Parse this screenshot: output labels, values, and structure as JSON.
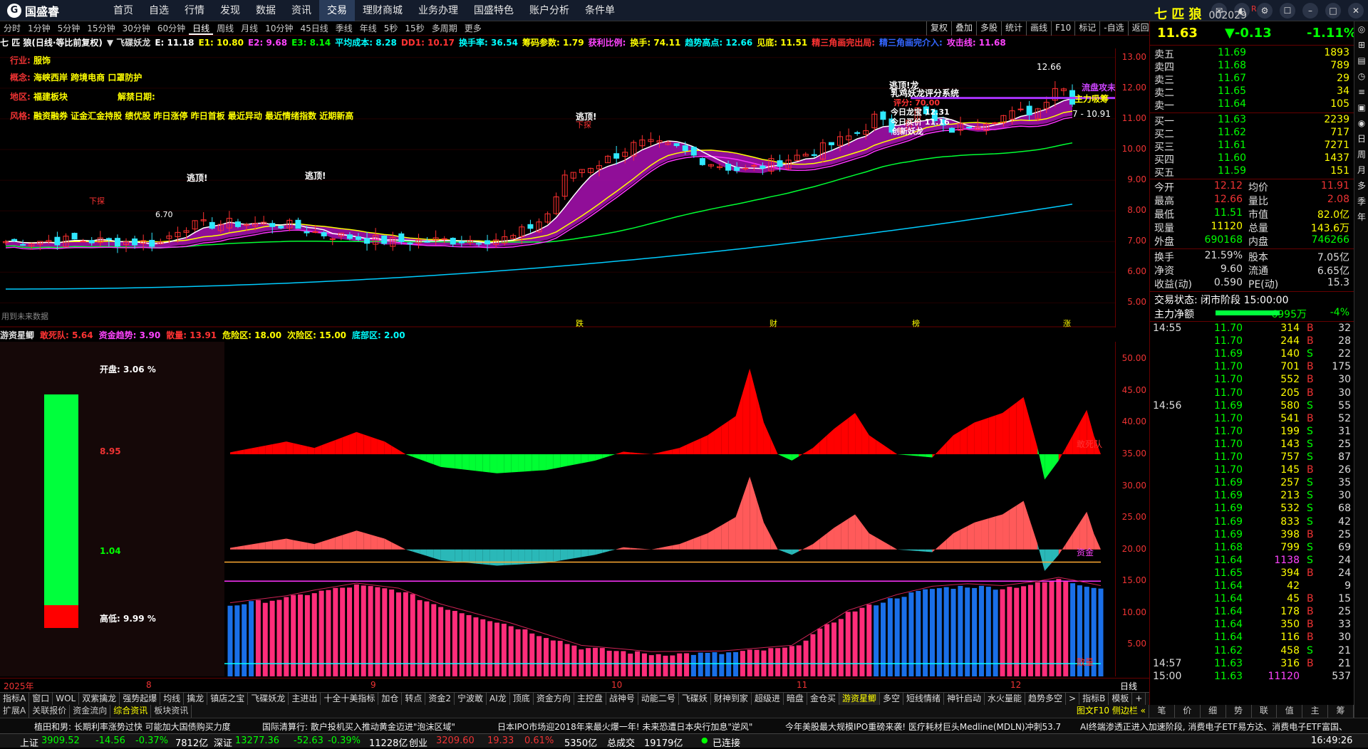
{
  "app": {
    "name": "国盛睿"
  },
  "menu": [
    "首页",
    "自选",
    "行情",
    "发现",
    "数据",
    "资讯",
    "交易",
    "理财商城",
    "业务办理",
    "国盛特色",
    "账户分析",
    "条件单"
  ],
  "menu_active": 6,
  "periods": [
    "分时",
    "1分钟",
    "5分钟",
    "15分钟",
    "30分钟",
    "60分钟",
    "日线",
    "周线",
    "月线",
    "10分钟",
    "45日线",
    "季线",
    "年线",
    "5秒",
    "15秒",
    "多周期",
    "更多"
  ],
  "period_active": 6,
  "tools": [
    "复权",
    "叠加",
    "多股",
    "统计",
    "画线",
    "F10",
    "标记",
    "-自选",
    "返回"
  ],
  "indicator_line": [
    {
      "text": "七 匹 狼(日线·等比前复权)",
      "color": "#ffffff"
    },
    {
      "text": "▼ 飞碟妖龙",
      "color": "#dddddd"
    },
    {
      "text": "E: 11.18",
      "color": "#ffffff"
    },
    {
      "text": "E1: 10.80",
      "color": "#ffff00"
    },
    {
      "text": "E2: 9.68",
      "color": "#ff44ff"
    },
    {
      "text": "E3: 8.14",
      "color": "#00ff00"
    },
    {
      "text": "平均成本: 8.28",
      "color": "#00ffff"
    },
    {
      "text": "DD1: 10.17",
      "color": "#ff3333"
    },
    {
      "text": "换手率: 36.54",
      "color": "#00ffff"
    },
    {
      "text": "筹码参数: 1.79",
      "color": "#ffff00"
    },
    {
      "text": "获利比例:",
      "color": "#ff44ff"
    },
    {
      "text": "换手: 74.11",
      "color": "#ffff00"
    },
    {
      "text": "趋势高点: 12.66",
      "color": "#00ffff"
    },
    {
      "text": "见底: 11.51",
      "color": "#ffff00"
    },
    {
      "text": "精三角画完出局:",
      "color": "#ff3333"
    },
    {
      "text": "精三角画完介入:",
      "color": "#3366ff"
    },
    {
      "text": "攻击线: 11.68",
      "color": "#ff44ff"
    }
  ],
  "stock_info": {
    "industry_label": "行业:",
    "industry": "服饰",
    "concept_label": "概念:",
    "concept": "海峡西岸 跨境电商 口罩防护",
    "region_label": "地区:",
    "region": "福建板块",
    "unlock_label": "解禁日期:",
    "style_label": "风格:",
    "style": "融资融券 证金汇金持股 绩优股 昨日涨停 昨日首板 最近异动 最近情绪指数 近期新高"
  },
  "main_chart": {
    "y_ticks": [
      "13.00",
      "12.00",
      "11.00",
      "10.00",
      "9.00",
      "8.00",
      "7.00",
      "6.00",
      "5.00"
    ],
    "annotations": {
      "high_price": "12.66",
      "low_price": "6.70",
      "last_line": "7 - 10.91",
      "xiaocheng": "逃顶!",
      "xiaocheng2": "逃顶!",
      "xiaocheng3": "逃顶!",
      "xiaocheng4": "逃顶!龙",
      "xiafang": "下探",
      "xiafang2": "下探",
      "system": "乳鸡妖龙评分系统",
      "score_label": "评分: 70.00",
      "today_dragon": "今日龙宝 12.31",
      "today_buy": "今日买价 11.16",
      "create_new": "创新妖龙",
      "liudong": "流盘攻未",
      "main_force": "主力吸筹",
      "future": "用到未来数据",
      "events": [
        "跌",
        "财",
        "榜",
        "涨"
      ]
    }
  },
  "sub_chart": {
    "title": "游资星鲫",
    "legend": [
      {
        "text": "敢死队: 5.64",
        "color": "#ff3333"
      },
      {
        "text": "资金趋势: 3.90",
        "color": "#ff44ff"
      },
      {
        "text": "散量: 13.91",
        "color": "#ff3333"
      },
      {
        "text": "危险区: 18.00",
        "color": "#ffff00"
      },
      {
        "text": "次险区: 15.00",
        "color": "#ffff00"
      },
      {
        "text": "底部区: 2.00",
        "color": "#00ffff"
      }
    ],
    "y_ticks": [
      "50.00",
      "45.00",
      "40.00",
      "35.00",
      "30.00",
      "25.00",
      "20.00",
      "15.00",
      "10.00",
      "5.00"
    ],
    "labels": {
      "gansi": "敢死队",
      "zijin": "资金",
      "sanliang": "散量"
    }
  },
  "gauge": {
    "open_label": "开盘:",
    "open": "3.06 %",
    "upper": "8.95",
    "lower": "1.04",
    "hilo_label": "高低:",
    "hilo": "9.99 %"
  },
  "dates": [
    {
      "t": "2025年"
    },
    {
      "t": "8"
    },
    {
      "t": "9"
    },
    {
      "t": "10"
    },
    {
      "t": "11"
    },
    {
      "t": "12"
    }
  ],
  "date_period": "日线",
  "tabs1": [
    "指标A",
    "窗口",
    "WOL",
    "双紫擒龙",
    "强势起爆",
    "均线",
    "擒龙",
    "镇店之宝",
    "飞碟妖龙",
    "主进出",
    "十全十美指标",
    "加仓",
    "转点",
    "资金2",
    "宁波敢",
    "AI龙",
    "顶底",
    "资金方向",
    "主控盘",
    "战神号",
    "动能二号",
    "飞碟妖",
    "财神到家",
    "超级进",
    "暗盘",
    "金仓买",
    "游资星鲫",
    "多空",
    "短线情绪",
    "神针启动",
    "水火量能",
    "趋势多空",
    ">",
    "指标B",
    "模板",
    "+",
    "-"
  ],
  "tabs1_active": 26,
  "tabs2": [
    "扩展A",
    "关联报价",
    "资金流向",
    "综合资讯",
    "板块资讯"
  ],
  "tabs2_right": "图文F10 侧边栏 «",
  "right_panel": {
    "name": "七 匹 狼",
    "code": "002029",
    "mark": "R",
    "price": "11.63",
    "change": "▼-0.13",
    "pct": "-1.11%",
    "asks": [
      {
        "label": "卖五",
        "price": "11.69",
        "vol": "1893"
      },
      {
        "label": "卖四",
        "price": "11.68",
        "vol": "789"
      },
      {
        "label": "卖三",
        "price": "11.67",
        "vol": "29"
      },
      {
        "label": "卖二",
        "price": "11.65",
        "vol": "34"
      },
      {
        "label": "卖一",
        "price": "11.64",
        "vol": "105"
      }
    ],
    "bids": [
      {
        "label": "买一",
        "price": "11.63",
        "vol": "2239"
      },
      {
        "label": "买二",
        "price": "11.62",
        "vol": "717"
      },
      {
        "label": "买三",
        "price": "11.61",
        "vol": "7271"
      },
      {
        "label": "买四",
        "price": "11.60",
        "vol": "1437"
      },
      {
        "label": "买五",
        "price": "11.59",
        "vol": "151"
      }
    ],
    "stats": [
      {
        "l1": "今开",
        "v1": "12.12",
        "l2": "均价",
        "v2": "11.91"
      },
      {
        "l1": "最高",
        "v1": "12.66",
        "l2": "量比",
        "v2": "2.08"
      },
      {
        "l1": "最低",
        "v1": "11.51",
        "l2": "市值",
        "v2": "82.0亿"
      },
      {
        "l1": "现量",
        "v1": "11120",
        "l2": "总量",
        "v2": "143.6万"
      },
      {
        "l1": "外盘",
        "v1": "690168",
        "l2": "内盘",
        "v2": "746266"
      }
    ],
    "stats2": [
      {
        "l1": "换手",
        "v1": "21.59%",
        "l2": "股本",
        "v2": "7.05亿"
      },
      {
        "l1": "净资",
        "v1": "9.60",
        "l2": "流通",
        "v2": "6.65亿"
      },
      {
        "l1": "收益(动)",
        "v1": "0.590",
        "l2": "PE(动)",
        "v2": "15.3"
      }
    ],
    "trade_state": "交易状态: 闭市阶段 15:00:00",
    "net_label": "主力净额",
    "net_value": "-6995万",
    "net_pct": "-4%",
    "ticks": [
      {
        "time": "14:55",
        "price": "11.70",
        "vol": "314",
        "bs": "B",
        "n": "32"
      },
      {
        "time": "",
        "price": "11.70",
        "vol": "244",
        "bs": "B",
        "n": "28"
      },
      {
        "time": "",
        "price": "11.69",
        "vol": "140",
        "bs": "S",
        "n": "22"
      },
      {
        "time": "",
        "price": "11.70",
        "vol": "701",
        "bs": "B",
        "n": "175"
      },
      {
        "time": "",
        "price": "11.70",
        "vol": "552",
        "bs": "B",
        "n": "30"
      },
      {
        "time": "",
        "price": "11.70",
        "vol": "205",
        "bs": "B",
        "n": "30"
      },
      {
        "time": "14:56",
        "price": "11.69",
        "vol": "580",
        "bs": "S",
        "n": "55"
      },
      {
        "time": "",
        "price": "11.70",
        "vol": "541",
        "bs": "B",
        "n": "52"
      },
      {
        "time": "",
        "price": "11.70",
        "vol": "199",
        "bs": "S",
        "n": "31"
      },
      {
        "time": "",
        "price": "11.70",
        "vol": "143",
        "bs": "S",
        "n": "25"
      },
      {
        "time": "",
        "price": "11.70",
        "vol": "757",
        "bs": "S",
        "n": "87"
      },
      {
        "time": "",
        "price": "11.70",
        "vol": "145",
        "bs": "B",
        "n": "26"
      },
      {
        "time": "",
        "price": "11.69",
        "vol": "257",
        "bs": "S",
        "n": "35"
      },
      {
        "time": "",
        "price": "11.69",
        "vol": "213",
        "bs": "S",
        "n": "30"
      },
      {
        "time": "",
        "price": "11.69",
        "vol": "532",
        "bs": "S",
        "n": "68"
      },
      {
        "time": "",
        "price": "11.69",
        "vol": "833",
        "bs": "S",
        "n": "42"
      },
      {
        "time": "",
        "price": "11.69",
        "vol": "398",
        "bs": "B",
        "n": "25"
      },
      {
        "time": "",
        "price": "11.68",
        "vol": "799",
        "bs": "S",
        "n": "69"
      },
      {
        "time": "",
        "price": "11.64",
        "vol": "1138",
        "bs": "S",
        "n": "24"
      },
      {
        "time": "",
        "price": "11.65",
        "vol": "394",
        "bs": "B",
        "n": "24"
      },
      {
        "time": "",
        "price": "11.64",
        "vol": "42",
        "bs": "",
        "n": "9"
      },
      {
        "time": "",
        "price": "11.64",
        "vol": "45",
        "bs": "B",
        "n": "15"
      },
      {
        "time": "",
        "price": "11.64",
        "vol": "178",
        "bs": "B",
        "n": "25"
      },
      {
        "time": "",
        "price": "11.64",
        "vol": "350",
        "bs": "B",
        "n": "33"
      },
      {
        "time": "",
        "price": "11.64",
        "vol": "116",
        "bs": "B",
        "n": "30"
      },
      {
        "time": "",
        "price": "11.62",
        "vol": "458",
        "bs": "S",
        "n": "21"
      },
      {
        "time": "14:57",
        "price": "11.63",
        "vol": "316",
        "bs": "B",
        "n": "21"
      },
      {
        "time": "15:00",
        "price": "11.63",
        "vol": "11120",
        "bs": "",
        "n": "537"
      }
    ],
    "tabs": [
      "笔",
      "价",
      "细",
      "势",
      "联",
      "值",
      "主",
      "筹"
    ]
  },
  "vstrip": [
    "◎",
    "⊞",
    "▤",
    "◷",
    "≡",
    "▣",
    "◉",
    "日",
    "周",
    "月",
    "多",
    "季",
    "年"
  ],
  "news": [
    "植田和男: 长期利率涨势过快 可能加大国债购买力度",
    "国际清算行: 散户投机买入推动黄金迈进\"泡沫区域\"",
    "日本IPO市场迎2018年来最火爆一年! 未来恐遭日本央行加息\"逆风\"",
    "今年美股最大规模IPO重磅来袭! 医疗耗材巨头Medline(MDLN)冲刺53.7",
    "AI终端渗透正进入加速阶段, 消费电子ETF易方达、消费电子ETF富国、"
  ],
  "status": {
    "sh_label": "上证",
    "sh": "3909.52",
    "sh_chg": "-14.56",
    "sh_pct": "-0.37%",
    "sh_amt": "7812亿",
    "sz_label": "深证",
    "sz": "13277.36",
    "sz_chg": "-52.63",
    "sz_pct": "-0.39%",
    "sz_amt": "11228亿",
    "cy_label": "创业",
    "cy": "3209.60",
    "cy_chg": "19.33",
    "cy_pct": "0.61%",
    "cy_amt": "5350亿",
    "total_label": "总成交",
    "total": "19179亿",
    "conn": "已连接",
    "time": "16:49:26"
  }
}
